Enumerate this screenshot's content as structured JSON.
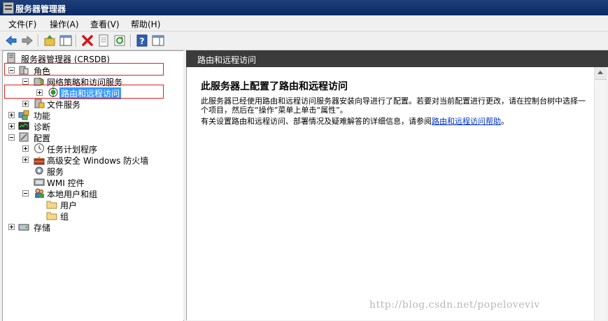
{
  "window": {
    "title": "服务器管理器"
  },
  "menu": [
    {
      "label": "文件(F)"
    },
    {
      "label": "操作(A)"
    },
    {
      "label": "查看(V)"
    },
    {
      "label": "帮助(H)"
    }
  ],
  "toolbar": {
    "icons": [
      "back-icon",
      "forward-icon",
      "up-folder-icon",
      "show-hide-tree-icon",
      "delete-icon",
      "properties-icon",
      "refresh-icon",
      "help-icon",
      "show-hide-action-pane-icon"
    ]
  },
  "tree": {
    "root": "服务器管理器 (CRSDB)",
    "roles": "角色",
    "npas": "网络策略和访问服务",
    "rras": "路由和远程访问",
    "file_services": "文件服务",
    "features": "功能",
    "diagnostics": "诊断",
    "configuration": "配置",
    "task_scheduler": "任务计划程序",
    "firewall": "高级安全 Windows 防火墙",
    "services": "服务",
    "wmi": "WMI 控件",
    "local_users_groups": "本地用户和组",
    "users": "用户",
    "groups": "组",
    "storage": "存储"
  },
  "right": {
    "header": "路由和远程访问",
    "title": "此服务器上配置了路由和远程访问",
    "para1": "此服务器已经使用路由和远程访问服务器安装向导进行了配置。若要对当前配置进行更改，请在控制台树中选择一个项目，然后在“操作”菜单上单击“属性”。",
    "para2_prefix": "有关设置路由和远程访问、部署情况及疑难解答的详细信息，请参阅",
    "para2_link": "路由和远程访问帮助",
    "para2_suffix": "。"
  },
  "watermark": "http://blog.csdn.net/popeloveviv",
  "colors": {
    "title_bar": "#0a2a66",
    "right_header": "#3b3b3b",
    "selection": "#3399ff",
    "highlight_box": "#e02020",
    "link": "#0033cc"
  }
}
